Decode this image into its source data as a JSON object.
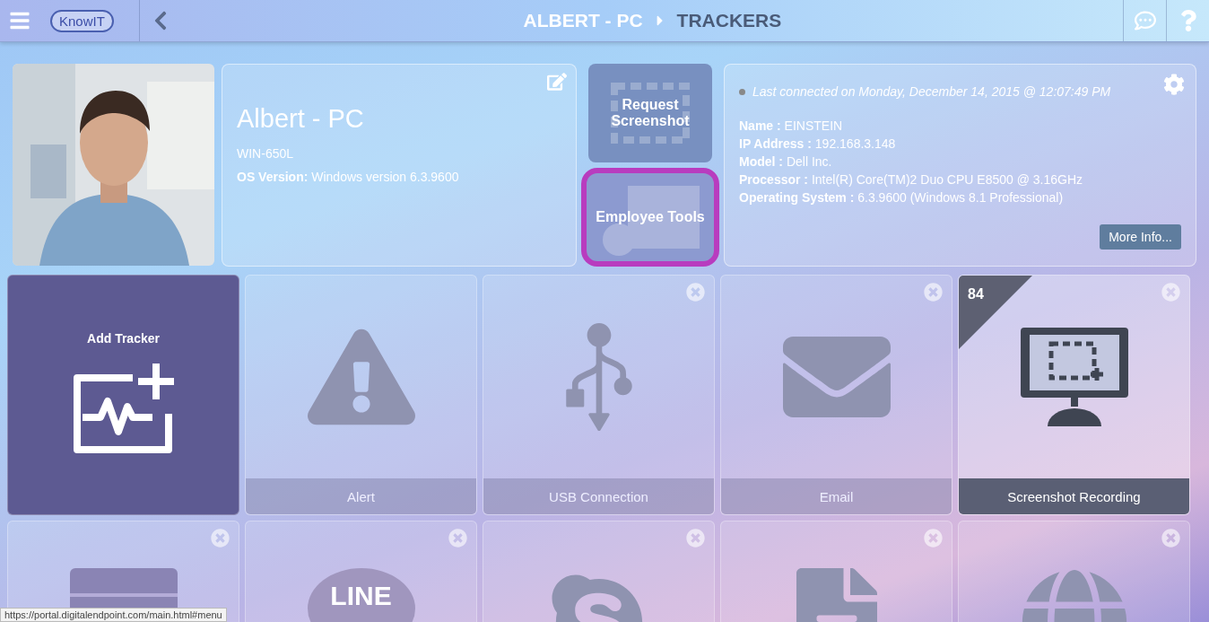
{
  "header": {
    "logo": "KnowIT",
    "breadcrumb": [
      {
        "label": "ALBERT - PC",
        "current": false
      },
      {
        "label": "TRACKERS",
        "current": true
      }
    ]
  },
  "device": {
    "title": "Albert - PC",
    "subtitle": "WIN-650L",
    "os_line": "**OS Version:** Windows version 6.3.9600"
  },
  "actions": [
    {
      "label": "Request Screenshot",
      "kind": "screenshot",
      "selected": false
    },
    {
      "label": "Employee Tools",
      "kind": "calendar",
      "selected": true
    }
  ],
  "connection": {
    "status": "Last connected on Monday, December 14, 2015 @ 12:07:49 PM",
    "online": false,
    "details": [
      "**Name :** EINSTEIN",
      "**IP Address :** 192.168.3.148",
      "**Model :** Dell Inc.",
      "**Processor :** Intel(R) Core(TM)2 Duo CPU E8500 @ 3.16GHz",
      "**Operating System :** 6.3.9600 (Windows 8.1 Professional)"
    ],
    "button": "More Info..."
  },
  "tiles": [
    {
      "kind": "add",
      "label": "Add Tracker",
      "removable": false
    },
    {
      "kind": "alert",
      "label": "Alert",
      "removable": false,
      "selected": false
    },
    {
      "kind": "usb",
      "label": "USB Connection",
      "removable": true,
      "selected": false
    },
    {
      "kind": "email",
      "label": "Email",
      "removable": true,
      "selected": false
    },
    {
      "kind": "screen",
      "label": "Screenshot Recording",
      "removable": true,
      "selected": true,
      "badge": "84"
    },
    {
      "kind": "list",
      "removable": true,
      "selected": false
    },
    {
      "kind": "line",
      "icon_text": "LINE",
      "removable": true,
      "selected": false
    },
    {
      "kind": "skype",
      "removable": true,
      "selected": false
    },
    {
      "kind": "document",
      "removable": true,
      "selected": false
    },
    {
      "kind": "globe",
      "removable": true,
      "selected": false
    }
  ],
  "status_url": "https://portal.digitalendpoint.com/main.html#menu"
}
